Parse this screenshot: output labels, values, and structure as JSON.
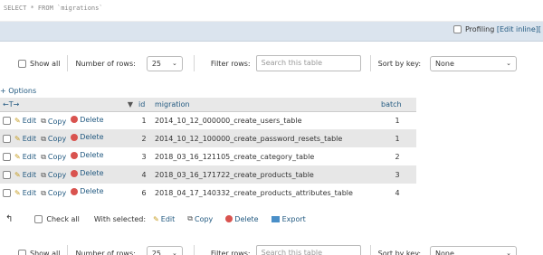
{
  "sql": "SELECT * FROM `migrations`",
  "profiling": {
    "label": "Profiling",
    "edit_inline": "[Edit inline]",
    "trail": "["
  },
  "nav": {
    "show_all": "Show all",
    "number_of_rows_label": "Number of rows:",
    "number_of_rows_value": "25",
    "filter_label": "Filter rows:",
    "filter_placeholder": "Search this table",
    "sort_label": "Sort by key:",
    "sort_value": "None"
  },
  "options_label": "+ Options",
  "table": {
    "headers": {
      "arrows": "←T→",
      "sort_marker": "▼",
      "id": "id",
      "migration": "migration",
      "batch": "batch"
    },
    "actions": {
      "edit": "Edit",
      "copy": "Copy",
      "delete": "Delete"
    },
    "rows": [
      {
        "id": "1",
        "migration": "2014_10_12_000000_create_users_table",
        "batch": "1"
      },
      {
        "id": "2",
        "migration": "2014_10_12_100000_create_password_resets_table",
        "batch": "1"
      },
      {
        "id": "3",
        "migration": "2018_03_16_121105_create_category_table",
        "batch": "2"
      },
      {
        "id": "4",
        "migration": "2018_03_16_171722_create_products_table",
        "batch": "3"
      },
      {
        "id": "6",
        "migration": "2018_04_17_140332_create_products_attributes_table",
        "batch": "4"
      }
    ]
  },
  "bulk": {
    "check_all": "Check all",
    "with_selected": "With selected:",
    "edit": "Edit",
    "copy": "Copy",
    "delete": "Delete",
    "export": "Export"
  },
  "colors": {
    "link": "#235a81",
    "stripe": "#e7e7e7",
    "profiling_bg": "#dbe4ee"
  },
  "icons": [
    "pencil-icon",
    "copy-icon",
    "delete-icon",
    "export-icon",
    "arrow-up-icon"
  ]
}
